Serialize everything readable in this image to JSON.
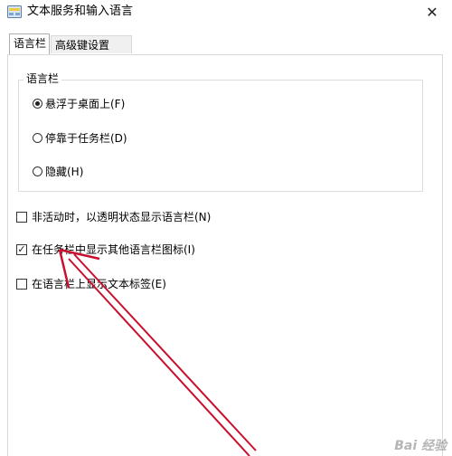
{
  "window": {
    "title": "文本服务和输入语言",
    "icon": "keyboard-settings-icon",
    "close_glyph": "✕"
  },
  "tabs": [
    {
      "label": "语言栏",
      "active": true
    },
    {
      "label": "高级键设置",
      "active": false
    }
  ],
  "language_bar_group": {
    "legend": "语言栏",
    "options": [
      {
        "label": "悬浮于桌面上(F)",
        "checked": true
      },
      {
        "label": "停靠于任务栏(D)",
        "checked": false
      },
      {
        "label": "隐藏(H)",
        "checked": false
      }
    ]
  },
  "checkboxes": [
    {
      "label": "非活动时，以透明状态显示语言栏(N)",
      "checked": false
    },
    {
      "label": "在任务栏中显示其他语言栏图标(I)",
      "checked": true
    },
    {
      "label": "在语言栏上显示文本标签(E)",
      "checked": false
    }
  ],
  "annotation": {
    "arrow_color": "#c8102e"
  },
  "watermark": {
    "text": "Bai 经验"
  }
}
